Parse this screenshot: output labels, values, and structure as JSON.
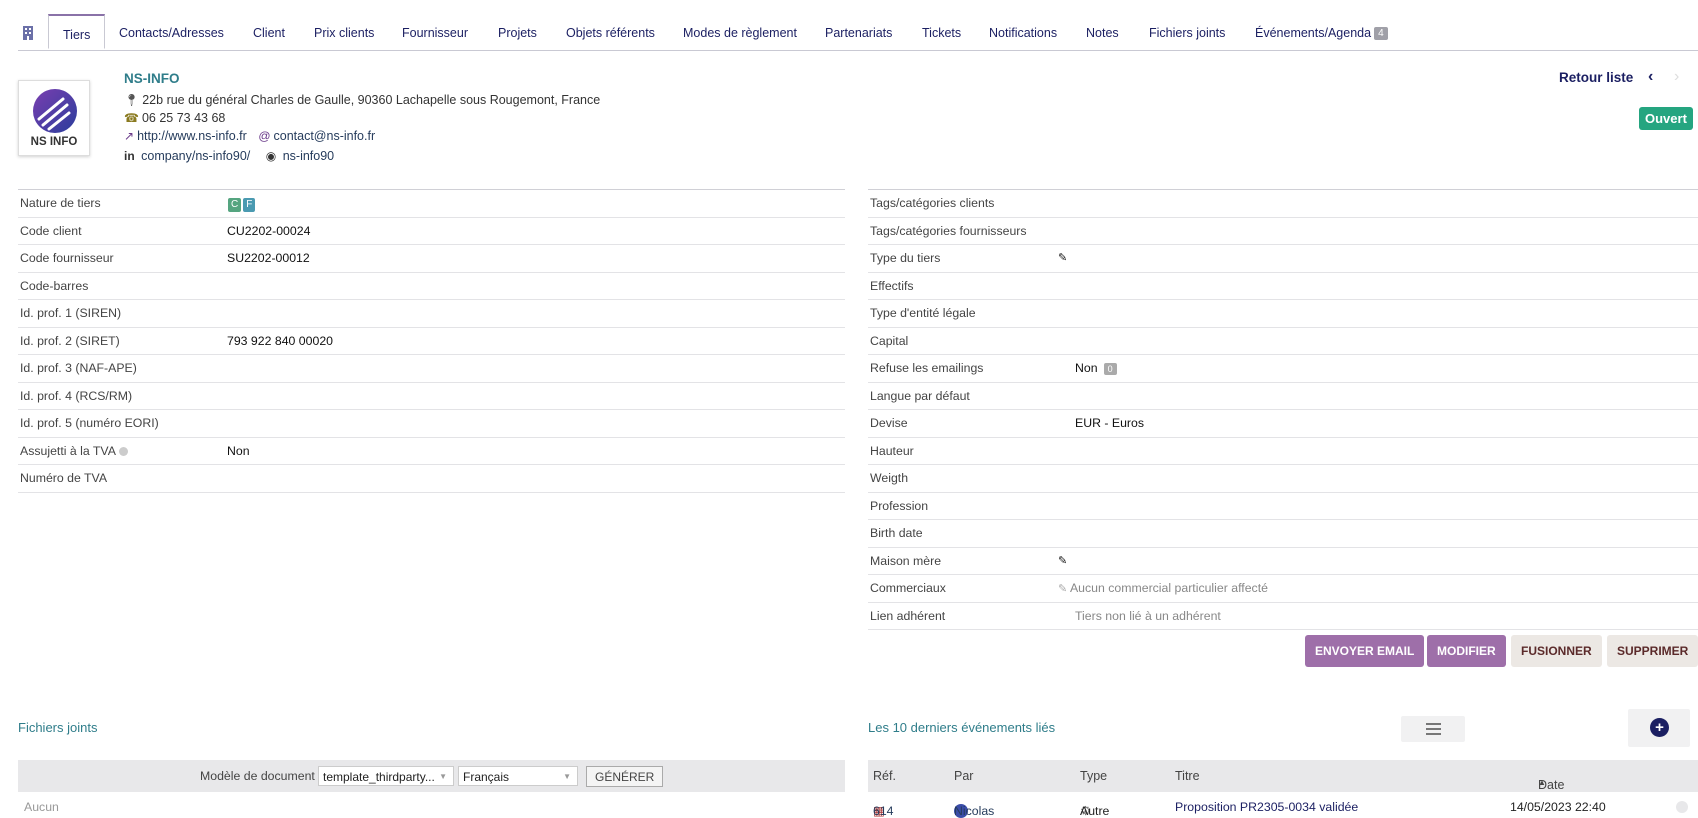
{
  "tabs": [
    {
      "label": "Tiers"
    },
    {
      "label": "Contacts/Adresses"
    },
    {
      "label": "Client"
    },
    {
      "label": "Prix clients"
    },
    {
      "label": "Fournisseur"
    },
    {
      "label": "Projets"
    },
    {
      "label": "Objets référents"
    },
    {
      "label": "Modes de règlement"
    },
    {
      "label": "Partenariats"
    },
    {
      "label": "Tickets"
    },
    {
      "label": "Notifications"
    },
    {
      "label": "Notes"
    },
    {
      "label": "Fichiers joints"
    },
    {
      "label": "Événements/Agenda",
      "badge": "4"
    }
  ],
  "header": {
    "company_name": "NS-INFO",
    "logo_text": "NS INFO",
    "address": "22b rue du général Charles de Gaulle, 90360 Lachapelle sous Rougemont, France",
    "phone": "06 25 73 43 68",
    "website": "http://www.ns-info.fr",
    "email": "contact@ns-info.fr",
    "linkedin": "company/ns-info90/",
    "github": "ns-info90",
    "back_to_list": "Retour liste",
    "status": "Ouvert",
    "status_color": "#25a580"
  },
  "left_fields": [
    {
      "label": "Nature de tiers",
      "value": ""
    },
    {
      "label": "Code client",
      "value": "CU2202-00024"
    },
    {
      "label": "Code fournisseur",
      "value": "SU2202-00012"
    },
    {
      "label": "Code-barres",
      "value": ""
    },
    {
      "label": "Id. prof. 1 (SIREN)",
      "value": ""
    },
    {
      "label": "Id. prof. 2 (SIRET)",
      "value": "793 922 840 00020"
    },
    {
      "label": "Id. prof. 3 (NAF-APE)",
      "value": ""
    },
    {
      "label": "Id. prof. 4 (RCS/RM)",
      "value": ""
    },
    {
      "label": "Id. prof. 5 (numéro EORI)",
      "value": ""
    },
    {
      "label": "Assujetti à la TVA",
      "value": "Non"
    },
    {
      "label": "Numéro de TVA",
      "value": ""
    }
  ],
  "nature_tags": [
    "C",
    "F"
  ],
  "right_fields": [
    {
      "label": "Tags/catégories clients",
      "value": ""
    },
    {
      "label": "Tags/catégories fournisseurs",
      "value": ""
    },
    {
      "label": "Type du tiers",
      "value": ""
    },
    {
      "label": "Effectifs",
      "value": ""
    },
    {
      "label": "Type d'entité légale",
      "value": ""
    },
    {
      "label": "Capital",
      "value": ""
    },
    {
      "label": "Refuse les emailings",
      "value": "Non",
      "badge": "0"
    },
    {
      "label": "Langue par défaut",
      "value": ""
    },
    {
      "label": "Devise",
      "value": "EUR - Euros"
    },
    {
      "label": "Hauteur",
      "value": ""
    },
    {
      "label": "Weigth",
      "value": ""
    },
    {
      "label": "Profession",
      "value": ""
    },
    {
      "label": "Birth date",
      "value": ""
    },
    {
      "label": "Maison mère",
      "value": ""
    },
    {
      "label": "Commerciaux",
      "value": "Aucun commercial particulier affecté"
    },
    {
      "label": "Lien adhérent",
      "value": "Tiers non lié à un adhérent"
    }
  ],
  "actions": {
    "send_email": "Envoyer email",
    "modify": "Modifier",
    "merge": "Fusionner",
    "delete": "Supprimer"
  },
  "files": {
    "title": "Fichiers joints",
    "model_label": "Modèle de document",
    "model_value": "template_thirdparty...",
    "lang_value": "Français",
    "generate": "GÉNÉRER",
    "empty": "Aucun"
  },
  "events": {
    "title": "Les 10 derniers événements liés",
    "columns": {
      "ref": "Réf.",
      "by": "Par",
      "type": "Type",
      "title": "Titre",
      "date": "Date"
    },
    "rows": [
      {
        "ref": "614",
        "by": "Nicolas",
        "type": "Autre",
        "title": "Proposition PR2305-0034 validée",
        "date": "14/05/2023 22:40"
      }
    ]
  }
}
